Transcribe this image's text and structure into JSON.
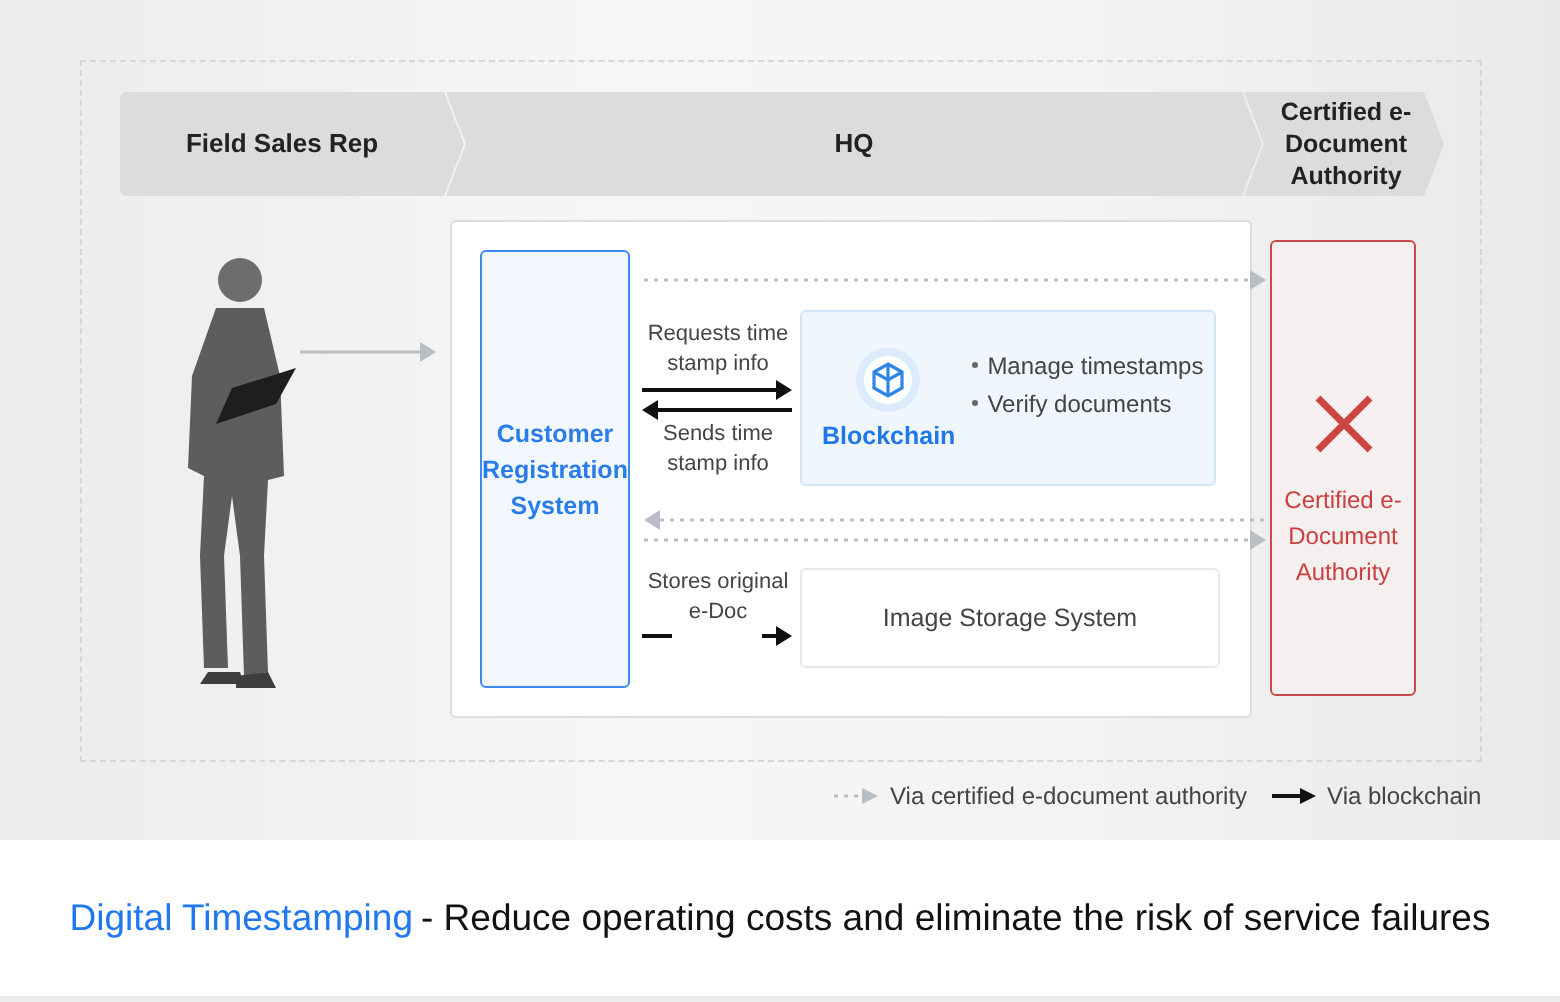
{
  "lanes": [
    {
      "label": "Field Sales Rep"
    },
    {
      "label": "HQ"
    },
    {
      "label": "Certified e-Document Authority"
    }
  ],
  "customer_system": {
    "label": "Customer Registration System"
  },
  "blockchain": {
    "label": "Blockchain",
    "bullets": [
      "Manage timestamps",
      "Verify documents"
    ]
  },
  "image_storage": {
    "label": "Image Storage System"
  },
  "authority": {
    "label": "Certified e-Document Authority",
    "unavailable": true
  },
  "flows": [
    {
      "kind": "dotted",
      "points_left": false
    },
    {
      "kind": "solid",
      "points_left": false,
      "label": "Requests time stamp info"
    },
    {
      "kind": "solid",
      "points_left": true,
      "label": "Sends time stamp info"
    },
    {
      "kind": "dotted",
      "points_left": true
    },
    {
      "kind": "dotted",
      "points_left": false
    },
    {
      "kind": "solid",
      "points_left": false,
      "label": "Stores original e-Doc"
    },
    {
      "kind": "plain",
      "points_left": false
    }
  ],
  "legend": [
    {
      "kind": "dotted",
      "label": "Via certified e-document authority"
    },
    {
      "kind": "solid",
      "label": "Via blockchain"
    }
  ],
  "caption": {
    "title": "Digital Timestamping",
    "text": "- Reduce operating costs and eliminate the risk of service failures"
  }
}
